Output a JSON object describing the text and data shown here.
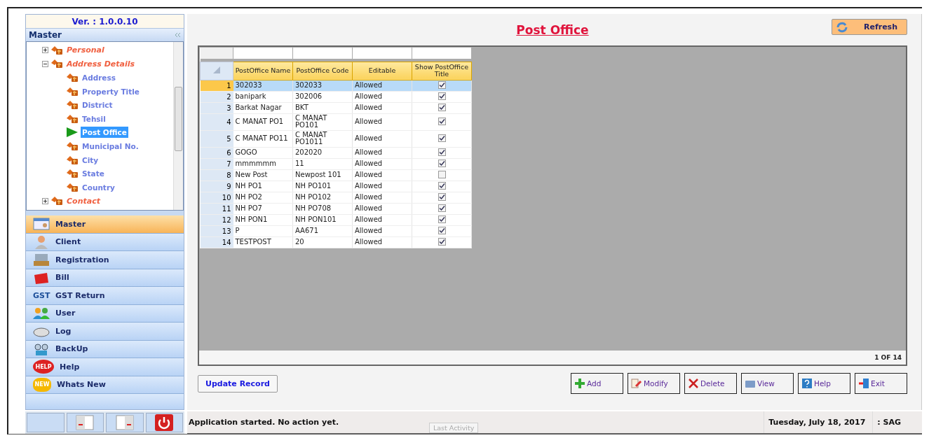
{
  "sidebar": {
    "version": "Ver. : 1.0.0.10",
    "tree": {
      "title": "Master",
      "items": [
        {
          "label": "Personal",
          "kind": "group",
          "expanded": false,
          "selected": false
        },
        {
          "label": "Address Details",
          "kind": "group",
          "expanded": true,
          "selected": false,
          "children": [
            {
              "label": "Address",
              "kind": "leaf",
              "selected": false
            },
            {
              "label": "Property Title",
              "kind": "leaf",
              "selected": false
            },
            {
              "label": "District",
              "kind": "leaf",
              "selected": false
            },
            {
              "label": "Tehsil",
              "kind": "leaf",
              "selected": false
            },
            {
              "label": "Post Office",
              "kind": "leaf",
              "selected": true
            },
            {
              "label": "Municipal No.",
              "kind": "leaf",
              "selected": false
            },
            {
              "label": "City",
              "kind": "leaf",
              "selected": false
            },
            {
              "label": "State",
              "kind": "leaf",
              "selected": false
            },
            {
              "label": "Country",
              "kind": "leaf",
              "selected": false
            }
          ]
        },
        {
          "label": "Contact",
          "kind": "group",
          "expanded": false,
          "selected": false
        }
      ]
    },
    "nav": [
      {
        "label": "Master",
        "kind": "master",
        "selected": true
      },
      {
        "label": "Client",
        "kind": "client",
        "selected": false
      },
      {
        "label": "Registration",
        "kind": "registration",
        "selected": false
      },
      {
        "label": "Bill",
        "kind": "bill",
        "selected": false
      },
      {
        "label": "GST Return",
        "kind": "gst",
        "icon_text": "GST",
        "selected": false
      },
      {
        "label": "User",
        "kind": "user",
        "selected": false
      },
      {
        "label": "Log",
        "kind": "log",
        "selected": false
      },
      {
        "label": "BackUp",
        "kind": "backup",
        "selected": false
      },
      {
        "label": "Help",
        "kind": "help",
        "icon_text": "HELP",
        "selected": false
      },
      {
        "label": "Whats New",
        "kind": "new",
        "icon_text": "NEW",
        "selected": false
      }
    ]
  },
  "page": {
    "title": "Post Office",
    "refresh": "Refresh"
  },
  "table": {
    "columns": [
      "PostOffice Name",
      "PostOffice Code",
      "Editable",
      "Show PostOffice Title"
    ],
    "rows": [
      {
        "num": "1",
        "name": "302033",
        "code": "302033",
        "editable": "Allowed",
        "show_title": true,
        "selected": true
      },
      {
        "num": "2",
        "name": "banipark",
        "code": "302006",
        "editable": "Allowed",
        "show_title": true,
        "selected": false
      },
      {
        "num": "3",
        "name": "Barkat Nagar",
        "code": "BKT",
        "editable": "Allowed",
        "show_title": true,
        "selected": false
      },
      {
        "num": "4",
        "name": "C MANAT PO1",
        "code": "C MANAT PO101",
        "editable": "Allowed",
        "show_title": true,
        "selected": false
      },
      {
        "num": "5",
        "name": "C MANAT PO11",
        "code": "C MANAT PO1011",
        "editable": "Allowed",
        "show_title": true,
        "selected": false
      },
      {
        "num": "6",
        "name": "GOGO",
        "code": "202020",
        "editable": "Allowed",
        "show_title": true,
        "selected": false
      },
      {
        "num": "7",
        "name": "mmmmmm",
        "code": "11",
        "editable": "Allowed",
        "show_title": true,
        "selected": false
      },
      {
        "num": "8",
        "name": "New Post",
        "code": "Newpost 101",
        "editable": "Allowed",
        "show_title": false,
        "selected": false
      },
      {
        "num": "9",
        "name": "NH PO1",
        "code": "NH PO101",
        "editable": "Allowed",
        "show_title": true,
        "selected": false
      },
      {
        "num": "10",
        "name": "NH PO2",
        "code": "NH PO102",
        "editable": "Allowed",
        "show_title": true,
        "selected": false
      },
      {
        "num": "11",
        "name": "NH PO7",
        "code": "NH PO708",
        "editable": "Allowed",
        "show_title": true,
        "selected": false
      },
      {
        "num": "12",
        "name": "NH PON1",
        "code": "NH PON101",
        "editable": "Allowed",
        "show_title": true,
        "selected": false
      },
      {
        "num": "13",
        "name": "P",
        "code": "AA671",
        "editable": "Allowed",
        "show_title": true,
        "selected": false
      },
      {
        "num": "14",
        "name": "TESTPOST",
        "code": "20",
        "editable": "Allowed",
        "show_title": true,
        "selected": false
      }
    ],
    "record_count": "1 OF 14"
  },
  "update_button": "Update Record",
  "actions": [
    {
      "label": "Add",
      "kind": "add"
    },
    {
      "label": "Modify",
      "kind": "modify"
    },
    {
      "label": "Delete",
      "kind": "delete"
    },
    {
      "label": "View",
      "kind": "view"
    },
    {
      "label": "Help",
      "kind": "help"
    },
    {
      "label": "Exit",
      "kind": "exit"
    }
  ],
  "status_bar": {
    "message": "Application started. No action yet.",
    "last_activity": "Last Activity",
    "date": "Tuesday, July 18, 2017",
    "user": ": SAG"
  }
}
